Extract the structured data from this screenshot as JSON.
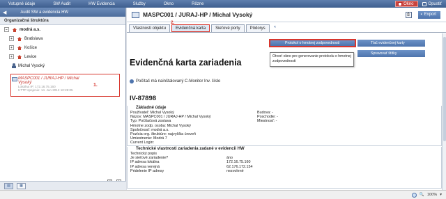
{
  "menu": {
    "items": [
      "Vstupné údaje",
      "SW Audit",
      "HW Evidencia",
      "Služby",
      "Okno",
      "Rôzne"
    ],
    "okno_button": "Okno",
    "exit_label": "Opustiť"
  },
  "left_panel": {
    "header_title": "Audit SW a evidencia HW",
    "section_label": "Organizačná štruktúra",
    "tree": [
      {
        "label": "modrá a.s.",
        "bold": true
      },
      {
        "label": "Bratislava"
      },
      {
        "label": "Košice"
      },
      {
        "label": "Levice"
      },
      {
        "label": "Michal Vysoký"
      }
    ],
    "selected_item": {
      "title": "MASPC001 / JURAJ-HP / Michal Vysoký",
      "line2": "Lokálna IP: 172.16.75.160",
      "line3": "HTTP spojenie: 14. Jun 2012 10:28:05",
      "annotation": "1."
    }
  },
  "header": {
    "title": "MASPC001 / JURAJ-HP / Michal Vysoký",
    "export_label": "Export"
  },
  "tabs": {
    "items": [
      "Vlastnosti objektu",
      "Evidenčná karta",
      "Sieťové porty",
      "Pôdorys"
    ],
    "active": "Evidenčná karta",
    "annotation": "2."
  },
  "content": {
    "heading": "Evidenčná karta zariadenia",
    "note": "Počítač má nainštalovaný C-Monitor Inv. číslo",
    "inventory_code": "IV-87898",
    "buttons": {
      "protokol": "Protokol o hmotnej zodpovednosti",
      "tlac": "Tlač evidenčnej karty",
      "spravovat": "Spravovať štítky"
    },
    "tooltip": "Otvorí okno pre generovanie protokolu o hmotnej zodpovednosti",
    "basic": {
      "title": "Základné údaje",
      "rows": [
        {
          "l": "Používateľ: Michal Vysoký",
          "r": "Budova: -"
        },
        {
          "l": "Názov: MASPC001 / JURAJ-HP / Michal Vysoký",
          "r": "Poschodie: -"
        },
        {
          "l": "Typ: Počítačová zostava",
          "r": "Miestnosť: -"
        },
        {
          "l": "Hmotne zodp. osoba: Michal Vysoký",
          "r": ""
        },
        {
          "l": "Spoločnosť: modrá a.s.",
          "r": ""
        },
        {
          "l": "Pozícia org. štruktúre: najvyššia úroveň",
          "r": ""
        },
        {
          "l": "Umiestnenie: Modrá 7",
          "r": ""
        },
        {
          "l": "Current Login:",
          "r": ""
        }
      ]
    },
    "tech": {
      "title": "Technické vlastnosti zariadenia zadané v evidencii HW",
      "rows": [
        {
          "l": "Technický popis",
          "r": ""
        },
        {
          "l": "Je sieťové zariadenie?",
          "r": "áno"
        },
        {
          "l": "IP adresa lokálna",
          "r": "172.16.75.160"
        },
        {
          "l": "IP adresa verejná",
          "r": "62.176.172.154"
        },
        {
          "l": "Pridelenie IP adresy",
          "r": "nezvolené"
        }
      ]
    }
  },
  "status": {
    "zoom": "100%"
  }
}
